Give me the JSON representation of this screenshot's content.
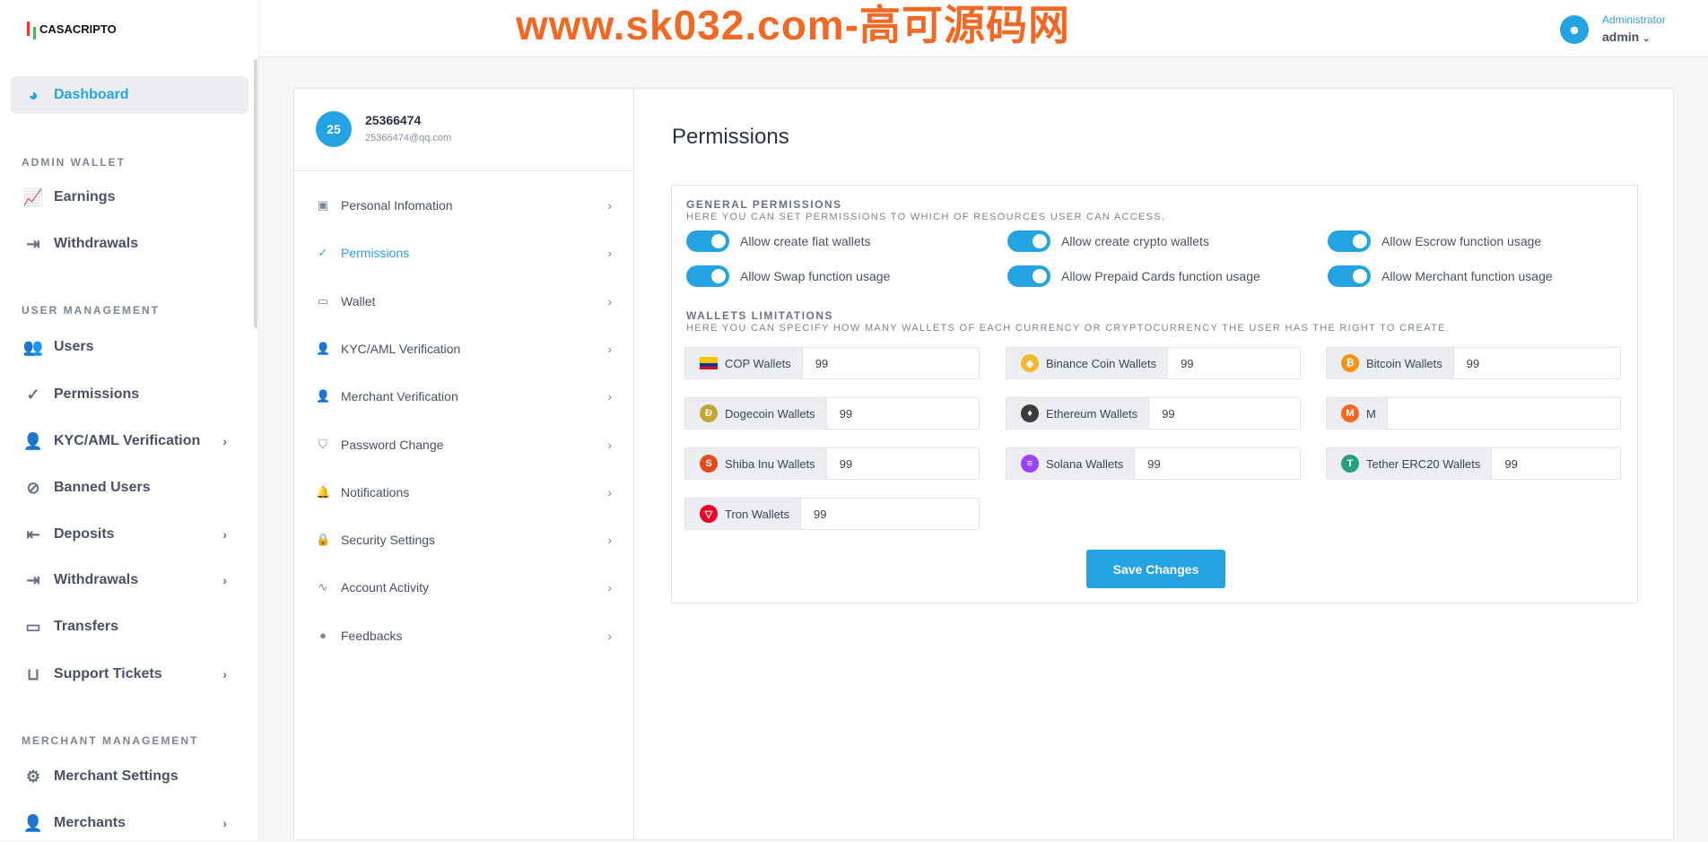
{
  "brand": "CASACRIPTO",
  "watermark": "www.sk032.com-高可源码网",
  "header": {
    "role": "Administrator",
    "username": "admin"
  },
  "sidebar": {
    "items": [
      {
        "label": "Dashboard",
        "icon": "dashboard-icon",
        "active": true
      },
      {
        "section": "ADMIN WALLET"
      },
      {
        "label": "Earnings",
        "icon": "chart-line-icon"
      },
      {
        "label": "Withdrawals",
        "icon": "export-icon"
      },
      {
        "section": "USER MANAGEMENT"
      },
      {
        "label": "Users",
        "icon": "users-icon"
      },
      {
        "label": "Permissions",
        "icon": "check-circle-icon"
      },
      {
        "label": "KYC/AML Verification",
        "icon": "user-check-icon",
        "chevron": true
      },
      {
        "label": "Banned Users",
        "icon": "ban-icon"
      },
      {
        "label": "Deposits",
        "icon": "import-icon",
        "chevron": true
      },
      {
        "label": "Withdrawals",
        "icon": "export-icon",
        "chevron": true
      },
      {
        "label": "Transfers",
        "icon": "wallet-icon"
      },
      {
        "label": "Support Tickets",
        "icon": "inbox-icon",
        "chevron": true
      },
      {
        "section": "MERCHANT MANAGEMENT"
      },
      {
        "label": "Merchant Settings",
        "icon": "gears-icon"
      },
      {
        "label": "Merchants",
        "icon": "user-check-icon",
        "chevron": true
      }
    ]
  },
  "profile": {
    "initials": "25",
    "name": "25366474",
    "email": "25366474@qq.com"
  },
  "profile_menu": [
    {
      "label": "Personal Infomation",
      "icon": "id-badge-icon"
    },
    {
      "label": "Permissions",
      "icon": "check-circle-icon",
      "active": true
    },
    {
      "label": "Wallet",
      "icon": "wallet-icon"
    },
    {
      "label": "KYC/AML Verification",
      "icon": "user-check-icon"
    },
    {
      "label": "Merchant Verification",
      "icon": "user-check-icon"
    },
    {
      "label": "Password Change",
      "icon": "shield-icon"
    },
    {
      "label": "Notifications",
      "icon": "bell-icon"
    },
    {
      "label": "Security Settings",
      "icon": "lock-icon"
    },
    {
      "label": "Account Activity",
      "icon": "activity-icon"
    },
    {
      "label": "Feedbacks",
      "icon": "chat-icon"
    }
  ],
  "page": {
    "title": "Permissions",
    "general_title": "GENERAL PERMISSIONS",
    "general_sub": "HERE YOU CAN SET PERMISSIONS TO WHICH OF RESOURCES USER CAN ACCESS.",
    "toggles": [
      {
        "label": "Allow create fiat wallets",
        "on": true
      },
      {
        "label": "Allow create crypto wallets",
        "on": true
      },
      {
        "label": "Allow Escrow function usage",
        "on": true
      },
      {
        "label": "Allow Swap function usage",
        "on": true
      },
      {
        "label": "Allow Prepaid Cards function usage",
        "on": true
      },
      {
        "label": "Allow Merchant function usage",
        "on": true
      }
    ],
    "limits_title": "WALLETS LIMITATIONS",
    "limits_sub": "HERE YOU CAN SPECIFY HOW MANY WALLETS OF EACH CURRENCY OR CRYPTOCURRENCY THE USER HAS THE RIGHT TO CREATE.",
    "wallets": [
      {
        "label": "COP Wallets",
        "value": "99",
        "color": "#f7c600",
        "glyph": ""
      },
      {
        "label": "Binance Coin Wallets",
        "value": "99",
        "color": "#f3ba2f",
        "glyph": "◆"
      },
      {
        "label": "Bitcoin Wallets",
        "value": "99",
        "color": "#f7931a",
        "glyph": "₿"
      },
      {
        "label": "Dogecoin Wallets",
        "value": "99",
        "color": "#c2a633",
        "glyph": "Ð"
      },
      {
        "label": "Ethereum Wallets",
        "value": "99",
        "color": "#3c3c3d",
        "glyph": "♦"
      },
      {
        "label": "M",
        "value": "",
        "color": "#f26822",
        "glyph": "M"
      },
      {
        "label": "Shiba Inu Wallets",
        "value": "99",
        "color": "#e44a1a",
        "glyph": "S"
      },
      {
        "label": "Solana Wallets",
        "value": "99",
        "color": "#9945ff",
        "glyph": "≡"
      },
      {
        "label": "Tether ERC20 Wallets",
        "value": "99",
        "color": "#26a17b",
        "glyph": "T"
      },
      {
        "label": "Tron Wallets",
        "value": "99",
        "color": "#eb0029",
        "glyph": "▽"
      }
    ],
    "save_label": "Save Changes"
  }
}
